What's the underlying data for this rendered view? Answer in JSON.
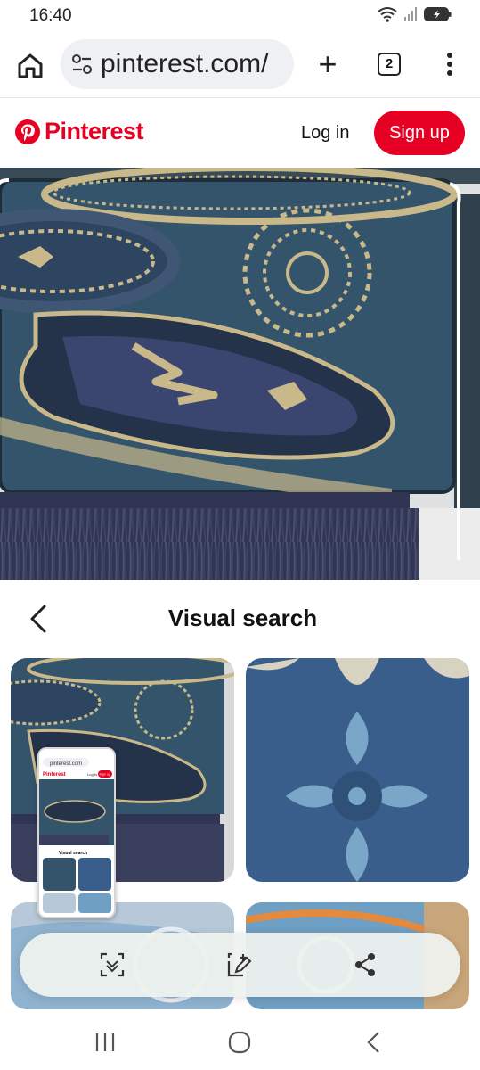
{
  "status_bar": {
    "time": "16:40"
  },
  "browser": {
    "url": "pinterest.com/",
    "tab_count": "2",
    "icons": [
      "home-icon",
      "site-settings-icon",
      "new-tab-icon",
      "tabs-icon",
      "more-icon"
    ]
  },
  "pinterest": {
    "logo_text": "Pinterest",
    "login_label": "Log in",
    "signup_label": "Sign up",
    "brand_color": "#e60023"
  },
  "visual_search": {
    "title": "Visual search"
  },
  "toolbar": {
    "icons": [
      "scan-icon",
      "edit-icon",
      "share-icon"
    ]
  },
  "nav": {
    "icons": [
      "recents-icon",
      "home-circle-icon",
      "back-nav-icon"
    ]
  },
  "screenshot_preview": {
    "url": "pinterest.com",
    "login_label": "Log in",
    "signup_label": "Sign up",
    "title": "Visual search"
  }
}
